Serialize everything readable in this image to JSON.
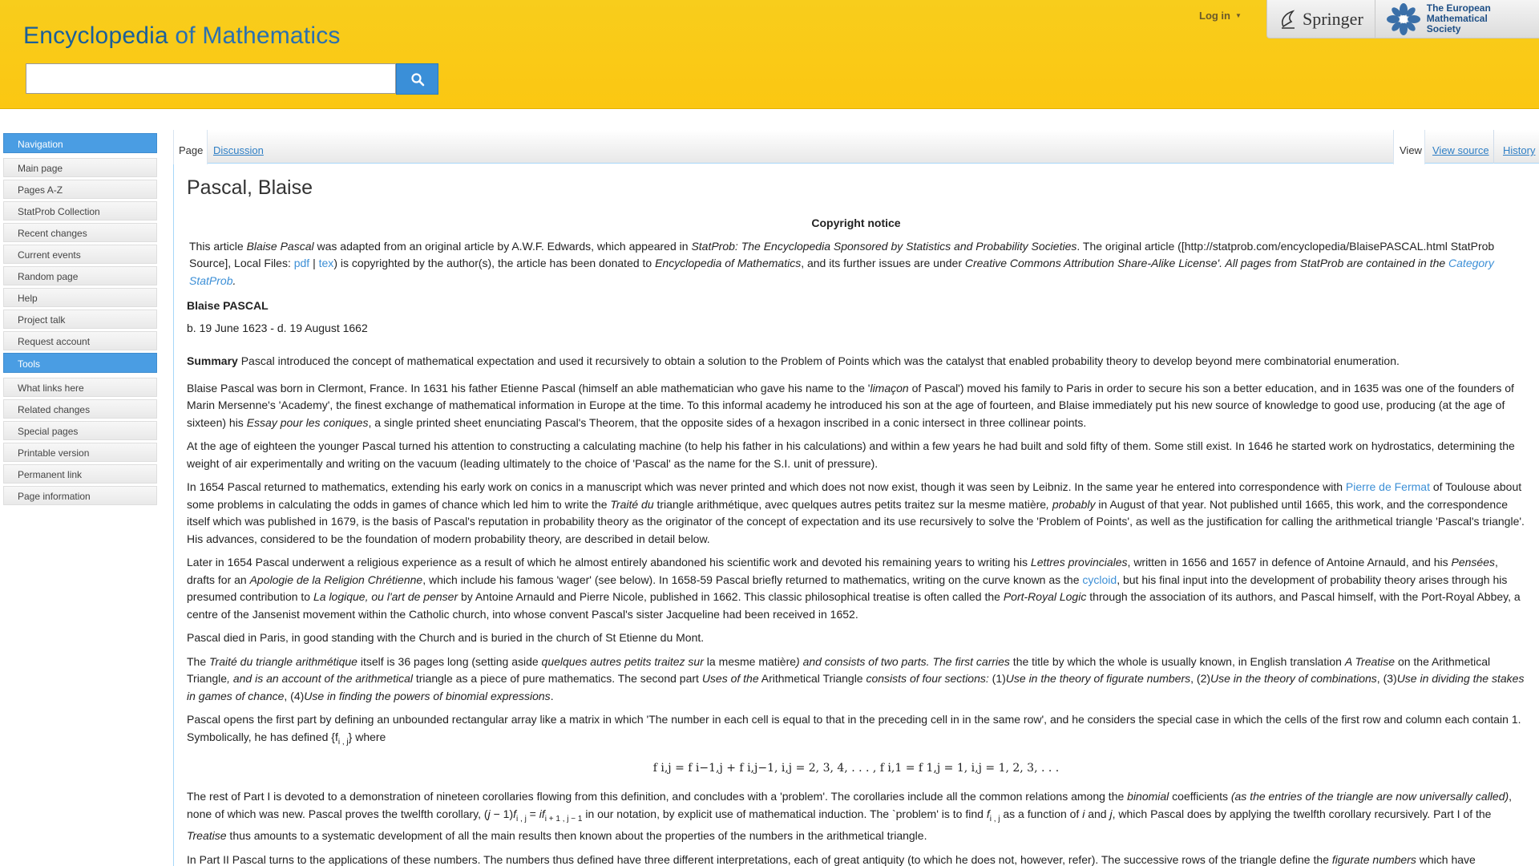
{
  "header": {
    "logo_bold": "Encyclopedia",
    "logo_light": " of Mathematics",
    "search_placeholder": "",
    "login": "Log in",
    "springer": "Springer",
    "ems": "The European Mathematical Society"
  },
  "sidebar": {
    "navigation_title": "Navigation",
    "navigation": [
      "Main page",
      "Pages A-Z",
      "StatProb Collection",
      "Recent changes",
      "Current events",
      "Random page",
      "Help",
      "Project talk",
      "Request account"
    ],
    "tools_title": "Tools",
    "tools": [
      "What links here",
      "Related changes",
      "Special pages",
      "Printable version",
      "Permanent link",
      "Page information"
    ]
  },
  "tabs": {
    "page": "Page",
    "discussion": "Discussion",
    "view": "View",
    "view_source": "View source",
    "history": "History"
  },
  "article": {
    "title": "Pascal, Blaise",
    "copyright_heading": "Copyright notice",
    "notice": {
      "t1": "This article ",
      "t2": "Blaise Pascal",
      "t3": " was adapted from an original article by A.W.F. Edwards, which appeared in ",
      "t4": "StatProb: The Encyclopedia Sponsored by Statistics and Probability Societies",
      "t5": ". The original article ([http://statprob.com/encyclopedia/BlaisePASCAL.html StatProb Source], Local Files: ",
      "pdf": "pdf",
      "bar": " | ",
      "tex": "tex",
      "t6": ") is copyrighted by the author(s), the article has been donated to ",
      "t7": "Encyclopedia of Mathematics",
      "t8": ", and its further issues are under ",
      "t9": "Creative Commons Attribution Share-Alike License'. All pages from StatProb are contained in the ",
      "cat": "Category StatProb",
      "t10": "."
    },
    "name_heading": "Blaise PASCAL",
    "dates": "b. 19 June 1623 - d. 19 August 1662",
    "summary_label": "Summary",
    "summary_text": " Pascal introduced the concept of mathematical expectation and used it recursively to obtain a solution to the Problem of Points which was the catalyst that enabled probability theory to develop beyond mere combinatorial enumeration.",
    "p1": {
      "a": "Blaise Pascal was born in Clermont, France. In 1631 his father Etienne Pascal (himself an able mathematician who gave his name to the '",
      "b": "limaçon",
      "c": " of Pascal') moved his family to Paris in order to secure his son a better education, and in 1635 was one of the founders of Marin Mersenne's 'Academy', the finest exchange of mathematical information in Europe at the time. To this informal academy he introduced his son at the age of fourteen, and Blaise immediately put his new source of knowledge to good use, producing (at the age of sixteen) his ",
      "d": "Essay pour les coniques",
      "e": ", a single printed sheet enunciating Pascal's Theorem, that the opposite sides of a hexagon inscribed in a conic intersect in three collinear points."
    },
    "p2": "At the age of eighteen the younger Pascal turned his attention to constructing a calculating machine (to help his father in his calculations) and within a few years he had built and sold fifty of them. Some still exist. In 1646 he started work on hydrostatics, determining the weight of air experimentally and writing on the vacuum (leading ultimately to the choice of 'Pascal' as the name for the S.I. unit of pressure).",
    "p3": {
      "a": "In 1654 Pascal returned to mathematics, extending his early work on conics in a manuscript which was never printed and which does not now exist, though it was seen by Leibniz. In the same year he entered into correspondence with ",
      "link": "Pierre de Fermat",
      "b": " of Toulouse about some problems in calculating the odds in games of chance which led him to write the ",
      "c": "Traité du",
      "d": " triangle arithmétique, avec quelques autres petits traitez sur la mesme matière",
      "e": ", probably",
      "f": " in August of that year. Not published until 1665, this work, and the correspondence itself which was published in 1679, is the basis of Pascal's reputation in probability theory as the originator of the concept of expectation and its use recursively to solve the 'Problem of Points', as well as the justification for calling the arithmetical triangle 'Pascal's triangle'. His advances, considered to be the foundation of modern probability theory, are described in detail below."
    },
    "p4": {
      "a": "Later in 1654 Pascal underwent a religious experience as a result of which he almost entirely abandoned his scientific work and devoted his remaining years to writing his ",
      "b": "Lettres provinciales",
      "c": ", written in 1656 and 1657 in defence of Antoine Arnauld, and his ",
      "d": "Pensées",
      "e": ", drafts for an ",
      "f": "Apologie de la Religion Chrétienne",
      "g": ", which include his famous 'wager' (see below). In 1658-59 Pascal briefly returned to mathematics, writing on the curve known as the ",
      "link": "cycloid",
      "h": ", but his final input into the development of probability theory arises through his presumed contribution to ",
      "i": "La logique, ou l'art de penser",
      "j": " by Antoine Arnauld and Pierre Nicole, published in 1662. This classic philosophical treatise is often called the ",
      "k": "Port-Royal Logic",
      "l": " through the association of its authors, and Pascal himself, with the Port-Royal Abbey, a centre of the Jansenist movement within the Catholic church, into whose convent Pascal's sister Jacqueline had been received in 1652."
    },
    "p5": "Pascal died in Paris, in good standing with the Church and is buried in the church of St Etienne du Mont.",
    "p6": {
      "a": "The ",
      "b": "Traité du triangle arithmétique",
      "c": " itself is 36 pages long (setting aside ",
      "d": "quelques autres petits traitez sur",
      "e": " la mesme matière",
      "f": ") and consists of two parts. The first carries",
      "g": " the title by which the whole is usually known, in English translation ",
      "h": "A Treatise",
      "i": " on the Arithmetical Triangle",
      "j": ", and is an account of the arithmetical",
      "k": " triangle as a piece of pure mathematics. The second part ",
      "l": "Uses of the",
      "m": " Arithmetical Triangle ",
      "n": "consists of four sections:",
      "o": " (1)",
      "p": "Use in the theory of figurate numbers",
      "q": ", (2)",
      "r": "Use in the theory of combinations",
      "s": ", (3)",
      "t": "Use in dividing the stakes in games of chance",
      "u": ", (4)",
      "v": "Use in finding the powers of binomial expressions",
      "w": "."
    },
    "p7": "Pascal opens the first part by defining an unbounded rectangular array like a matrix in which 'The number in each cell is equal to that in the preceding cell in in the same row', and he considers the special case in which the cells of the first row and column each contain 1. Symbolically, he has defined {f",
    "p7_sub": "i , j",
    "p7_end": "} where",
    "formula": "f i,j = f i−1,j + f i,j−1, i,j = 2, 3, 4, . . . , f i,1 = f 1,j = 1, i,j = 1, 2, 3, . . .",
    "p8": {
      "a": "The rest of Part I is devoted to a demonstration of nineteen corollaries flowing from this definition, and concludes with a 'problem'. The corollaries include all the common relations among the ",
      "b": "binomial",
      "c": " coefficients ",
      "d": "(as the entries of the triangle are now universally called)",
      "e": ", none of which was new. Pascal proves the twelfth corollary, (",
      "f": "j",
      "g": " − 1)",
      "h": "f",
      "h_sub": "i , j",
      "i": " = ",
      "j": "if",
      "j_sub": "i + 1 , j − 1",
      "k": " in our notation, by explicit use of mathematical induction. The `problem' is to find ",
      "l": "f",
      "l_sub": "i , j",
      "m": " as a function of ",
      "n": "i",
      "o": " and ",
      "p": "j",
      "q": ", which Pascal does by applying the twelfth corollary recursively. Part I of the ",
      "r": "Treatise",
      "s": " thus amounts to a systematic development of all the main results then known about the properties of the numbers in the arithmetical triangle."
    },
    "p9": {
      "a": "In Part II Pascal turns to the applications of these numbers. The numbers thus defined have three different interpretations, each of great antiquity (to which he does not, however, refer). The successive rows of the triangle define the ",
      "b": "figurate numbers",
      "c": " which have"
    }
  },
  "colors": {
    "header": "#fbc712",
    "accent": "#4a9de3",
    "link": "#3c8fd6"
  },
  "icons": [
    "search-icon",
    "springer-logo-icon",
    "ems-logo-icon",
    "chevron-down-icon"
  ]
}
